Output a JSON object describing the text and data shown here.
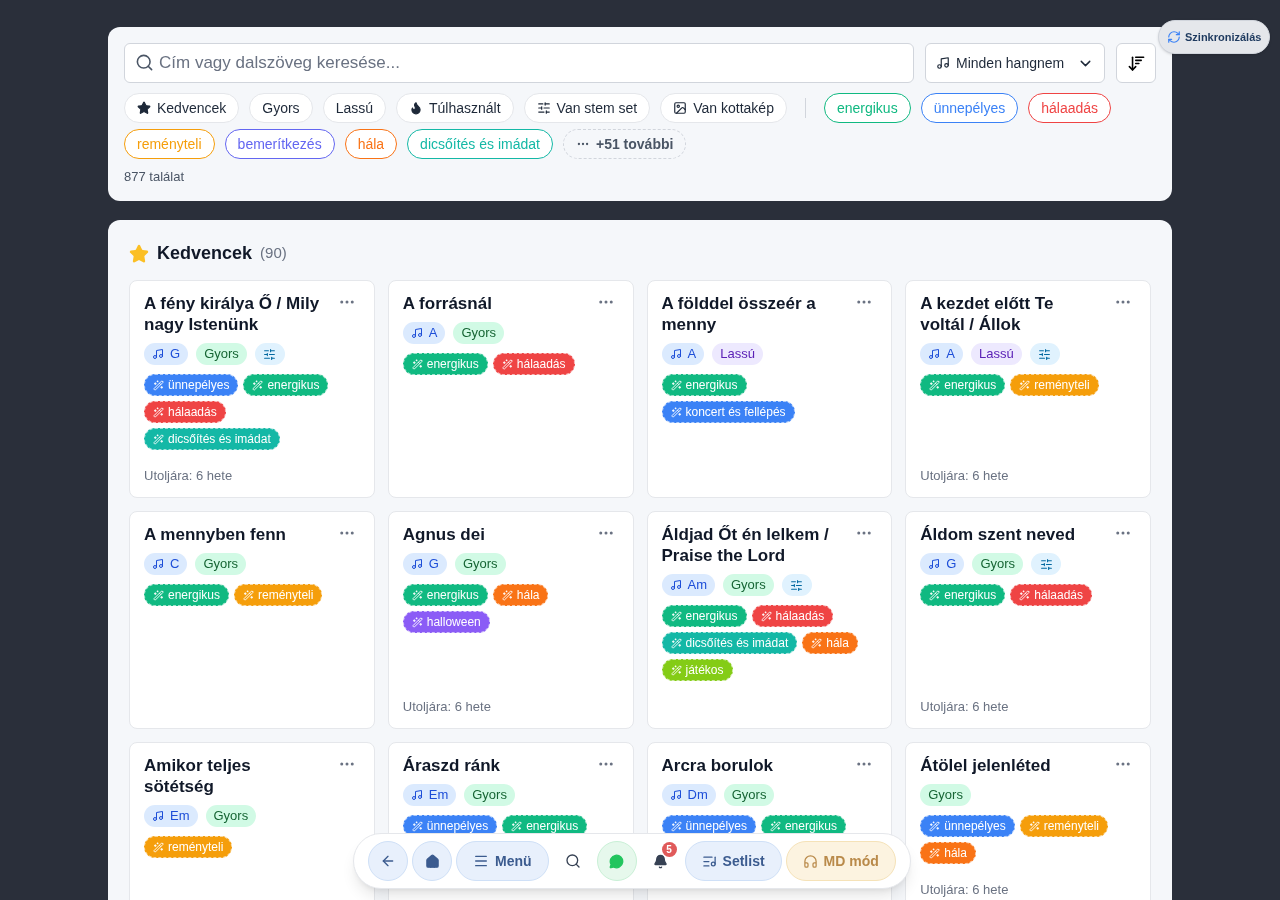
{
  "sync_button": {
    "label": "Szinkronizálás"
  },
  "search": {
    "placeholder": "Cím vagy dalszöveg keresése..."
  },
  "key_select": {
    "value": "Minden hangnem"
  },
  "filters": [
    {
      "kind": "favorites",
      "label": "Kedvencek"
    },
    {
      "kind": "plain",
      "label": "Gyors"
    },
    {
      "kind": "plain",
      "label": "Lassú"
    },
    {
      "kind": "overused",
      "label": "Túlhasznált"
    },
    {
      "kind": "stems",
      "label": "Van stem set"
    },
    {
      "kind": "sheet",
      "label": "Van kottakép"
    },
    {
      "kind": "mood",
      "label": "energikus",
      "color": "#10b981"
    },
    {
      "kind": "mood",
      "label": "ünnepélyes",
      "color": "#3b82f6"
    },
    {
      "kind": "mood",
      "label": "hálaadás",
      "color": "#ef4444"
    },
    {
      "kind": "mood",
      "label": "reményteli",
      "color": "#f59e0b"
    },
    {
      "kind": "mood",
      "label": "bemerítkezés",
      "color": "#6366f1"
    },
    {
      "kind": "mood",
      "label": "hála",
      "color": "#f97316"
    },
    {
      "kind": "mood",
      "label": "dicsőítés és imádat",
      "color": "#14b8a6"
    },
    {
      "kind": "more",
      "label": "+51 további"
    }
  ],
  "result_count": "877 találat",
  "favorites": {
    "title": "Kedvencek",
    "count": "(90)",
    "songs": [
      {
        "title": "A fény királya Ő / Mily nagy Istenünk",
        "key": "G",
        "tempo": {
          "label": "Gyors",
          "kind": "fast"
        },
        "stems": true,
        "tags": [
          {
            "label": "ünnepélyes",
            "color": "#3b82f6"
          },
          {
            "label": "energikus",
            "color": "#10b981"
          },
          {
            "label": "hálaadás",
            "color": "#ef4444"
          },
          {
            "label": "dicsőítés és imádat",
            "color": "#14b8a6"
          }
        ],
        "last_used": "Utoljára: 6 hete"
      },
      {
        "title": "A forrásnál",
        "key": "A",
        "tempo": {
          "label": "Gyors",
          "kind": "fast"
        },
        "stems": false,
        "tags": [
          {
            "label": "energikus",
            "color": "#10b981"
          },
          {
            "label": "hálaadás",
            "color": "#ef4444"
          }
        ]
      },
      {
        "title": "A földdel összeér a menny",
        "key": "A",
        "tempo": {
          "label": "Lassú",
          "kind": "slow"
        },
        "stems": false,
        "tags": [
          {
            "label": "energikus",
            "color": "#10b981"
          },
          {
            "label": "koncert és fellépés",
            "color": "#3b82f6"
          }
        ]
      },
      {
        "title": "A kezdet előtt Te voltál / Állok",
        "key": "A",
        "tempo": {
          "label": "Lassú",
          "kind": "slow"
        },
        "stems": true,
        "tags": [
          {
            "label": "energikus",
            "color": "#10b981"
          },
          {
            "label": "reményteli",
            "color": "#f59e0b"
          }
        ],
        "last_used": "Utoljára: 6 hete"
      },
      {
        "title": "A mennyben fenn",
        "key": "C",
        "tempo": {
          "label": "Gyors",
          "kind": "fast"
        },
        "stems": false,
        "tags": [
          {
            "label": "energikus",
            "color": "#10b981"
          },
          {
            "label": "reményteli",
            "color": "#f59e0b"
          }
        ]
      },
      {
        "title": "Agnus dei",
        "key": "G",
        "tempo": {
          "label": "Gyors",
          "kind": "fast"
        },
        "stems": false,
        "tags": [
          {
            "label": "energikus",
            "color": "#10b981"
          },
          {
            "label": "hála",
            "color": "#f97316"
          },
          {
            "label": "halloween",
            "color": "#8b5cf6"
          }
        ],
        "last_used": "Utoljára: 6 hete"
      },
      {
        "title": "Áldjad Őt én lelkem / Praise the Lord",
        "key": "Am",
        "tempo": {
          "label": "Gyors",
          "kind": "fast"
        },
        "stems": true,
        "tags": [
          {
            "label": "energikus",
            "color": "#10b981"
          },
          {
            "label": "hálaadás",
            "color": "#ef4444"
          },
          {
            "label": "dicsőítés és imádat",
            "color": "#14b8a6"
          },
          {
            "label": "hála",
            "color": "#f97316"
          },
          {
            "label": "játékos",
            "color": "#84cc16"
          }
        ]
      },
      {
        "title": "Áldom szent neved",
        "key": "G",
        "tempo": {
          "label": "Gyors",
          "kind": "fast"
        },
        "stems": true,
        "tags": [
          {
            "label": "energikus",
            "color": "#10b981"
          },
          {
            "label": "hálaadás",
            "color": "#ef4444"
          }
        ],
        "last_used": "Utoljára: 6 hete"
      },
      {
        "title": "Amikor teljes sötétség",
        "key": "Em",
        "tempo": {
          "label": "Gyors",
          "kind": "fast"
        },
        "stems": false,
        "tags": [
          {
            "label": "reményteli",
            "color": "#f59e0b"
          }
        ]
      },
      {
        "title": "Áraszd ránk",
        "key": "Em",
        "tempo": {
          "label": "Gyors",
          "kind": "fast"
        },
        "stems": false,
        "tags": [
          {
            "label": "ünnepélyes",
            "color": "#3b82f6"
          },
          {
            "label": "energikus",
            "color": "#10b981"
          }
        ]
      },
      {
        "title": "Arcra borulok",
        "key": "Dm",
        "tempo": {
          "label": "Gyors",
          "kind": "fast"
        },
        "stems": false,
        "tags": [
          {
            "label": "ünnepélyes",
            "color": "#3b82f6"
          },
          {
            "label": "energikus",
            "color": "#10b981"
          }
        ]
      },
      {
        "title": "Átölel jelenléted",
        "tempo": {
          "label": "Gyors",
          "kind": "fast"
        },
        "stems": false,
        "tags": [
          {
            "label": "ünnepélyes",
            "color": "#3b82f6"
          },
          {
            "label": "reményteli",
            "color": "#f59e0b"
          },
          {
            "label": "hála",
            "color": "#f97316"
          }
        ],
        "last_used": "Utoljára: 6 hete"
      }
    ]
  },
  "bottom_nav": [
    {
      "kind": "back"
    },
    {
      "kind": "home"
    },
    {
      "kind": "menu",
      "label": "Menü"
    },
    {
      "kind": "search"
    },
    {
      "kind": "chat"
    },
    {
      "kind": "bell",
      "badge": "5"
    },
    {
      "kind": "setlist",
      "label": "Setlist"
    },
    {
      "kind": "md",
      "label": "MD mód"
    }
  ]
}
